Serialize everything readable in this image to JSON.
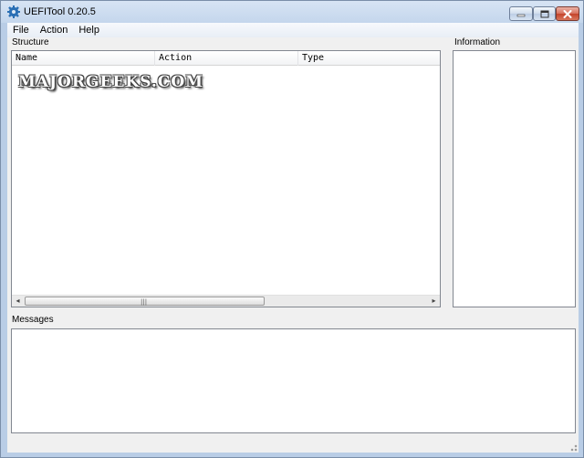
{
  "window": {
    "title": "UEFITool 0.20.5",
    "icon": "gear-icon",
    "controls": {
      "minimize_icon": "minimize-icon",
      "maximize_icon": "maximize-icon",
      "close_icon": "close-icon"
    }
  },
  "menu": {
    "items": [
      "File",
      "Action",
      "Help"
    ]
  },
  "structure": {
    "label": "Structure",
    "columns": [
      "Name",
      "Action",
      "Type"
    ],
    "scroll_left_glyph": "◂",
    "scroll_right_glyph": "▸",
    "thumb_grip": "|||"
  },
  "information": {
    "label": "Information"
  },
  "messages": {
    "label": "Messages"
  },
  "watermark": {
    "text": "MAJORGEEKS.COM"
  },
  "colors": {
    "titlebar": "#c4d6ec",
    "client": "#f0f0f0",
    "panel_border": "#828790",
    "close_button": "#c4442b"
  }
}
